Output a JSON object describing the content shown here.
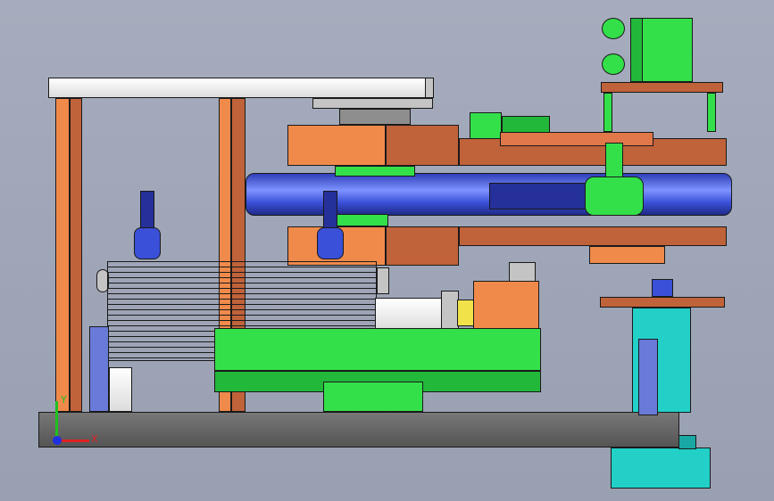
{
  "viewport": {
    "title": "",
    "colors": {
      "background": "#a2a8ba",
      "frame": "#f08a4b",
      "frame_dark": "#c0623a",
      "cylinder": "#ffffff",
      "base_plate": "#33e04a",
      "belt": "#3a50d8",
      "cylinder_block": "#22d0c8",
      "ground_plate": "#5e5e5e"
    }
  },
  "triad": {
    "x_label": "X",
    "y_label": "Y",
    "x_color": "#e02020",
    "y_color": "#20c020",
    "z_color": "#2030e0"
  }
}
